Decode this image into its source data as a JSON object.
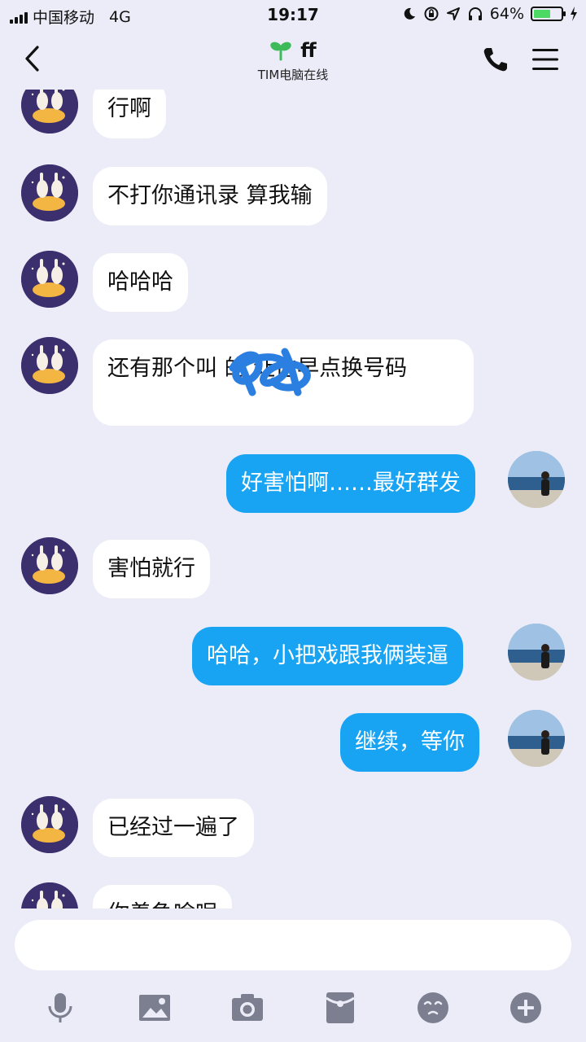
{
  "status_bar": {
    "carrier": "中国移动",
    "network": "4G",
    "time": "19:17",
    "battery_percent": "64%",
    "battery_level": 0.64
  },
  "header": {
    "title": "ff",
    "subtitle": "TIM电脑在线"
  },
  "messages": [
    {
      "from": "other",
      "text": "行啊"
    },
    {
      "from": "other",
      "text": "不打你通讯录 算我输"
    },
    {
      "from": "other",
      "text": "哈哈哈"
    },
    {
      "from": "other",
      "text": "还有那个叫        的 让他早点换号码"
    },
    {
      "from": "me",
      "text": "好害怕啊……最好群发"
    },
    {
      "from": "other",
      "text": "害怕就行"
    },
    {
      "from": "me",
      "text": "哈哈，小把戏跟我俩装逼"
    },
    {
      "from": "me",
      "text": "继续，等你"
    },
    {
      "from": "other",
      "text": "已经过一遍了"
    },
    {
      "from": "other",
      "text": "你着急啥呢"
    }
  ],
  "input": {
    "value": ""
  },
  "toolbar": {
    "icons": [
      "microphone-icon",
      "image-icon",
      "camera-icon",
      "red-packet-icon",
      "emoji-icon",
      "plus-icon"
    ]
  },
  "colors": {
    "background": "#ebecf7",
    "my_bubble": "#19a4f3",
    "their_bubble": "#ffffff",
    "scribble": "#2a7fe0"
  }
}
